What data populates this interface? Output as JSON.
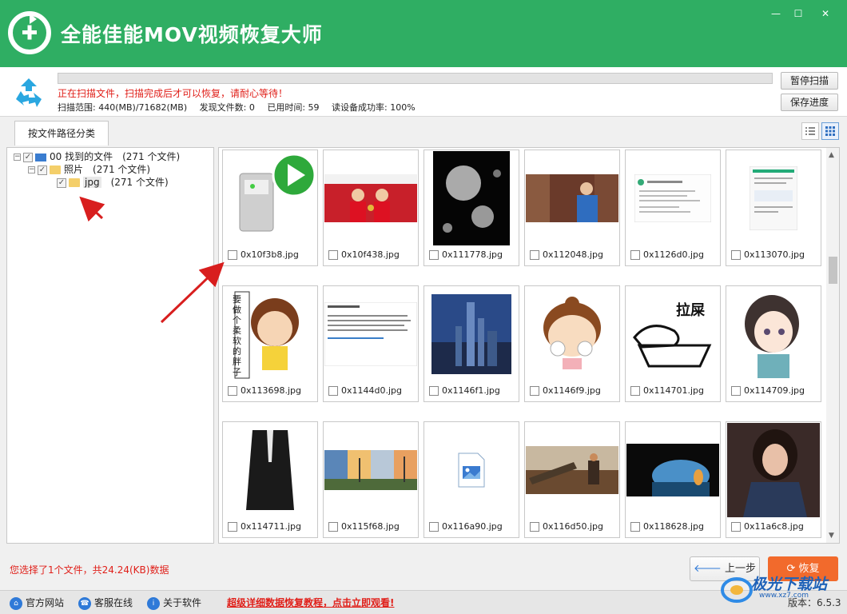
{
  "app": {
    "title": "全能佳能MOV视频恢复大师",
    "brand_color": "#2fae63"
  },
  "window_controls": {
    "minimize": "—",
    "maximize": "☐",
    "close": "✕"
  },
  "scan": {
    "message": "正在扫描文件，扫描完成后才可以恢复，请耐心等待！",
    "progress_fraction": 0.0,
    "range_label": "扫描范围: 440(MB)/71682(MB)",
    "found_label": "发现文件数: 0",
    "elapsed_label": "已用时间: 59",
    "success_label": "读设备成功率: 100%",
    "pause_button": "暂停扫描",
    "save_button": "保存进度"
  },
  "tabs": {
    "by_path": "按文件路径分类"
  },
  "tree": {
    "root": {
      "label": "00 找到的文件",
      "count": "(271 个文件)"
    },
    "photos": {
      "label": "照片",
      "count": "(271 个文件)"
    },
    "jpg": {
      "label": "jpg",
      "count": "(271 个文件)"
    }
  },
  "files": [
    {
      "name": "0x10f3b8.jpg",
      "kind": "player-icon",
      "checked": false
    },
    {
      "name": "0x10f438.jpg",
      "kind": "photo-athletes",
      "checked": false
    },
    {
      "name": "0x111778.jpg",
      "kind": "photo-moons",
      "checked": false
    },
    {
      "name": "0x112048.jpg",
      "kind": "photo-person-street",
      "checked": false
    },
    {
      "name": "0x1126d0.jpg",
      "kind": "screenshot-text",
      "checked": false
    },
    {
      "name": "0x113070.jpg",
      "kind": "screenshot-phone",
      "checked": false
    },
    {
      "name": "0x113698.jpg",
      "kind": "cartoon-girl",
      "checked": false
    },
    {
      "name": "0x1144d0.jpg",
      "kind": "screenshot-post",
      "checked": false
    },
    {
      "name": "0x1146f1.jpg",
      "kind": "photo-skyline",
      "checked": false
    },
    {
      "name": "0x1146f9.jpg",
      "kind": "cartoon-chibi",
      "checked": false
    },
    {
      "name": "0x114701.jpg",
      "kind": "sketch-bird",
      "checked": false
    },
    {
      "name": "0x114709.jpg",
      "kind": "anime-girl",
      "checked": false
    },
    {
      "name": "0x114711.jpg",
      "kind": "photo-suit",
      "checked": false
    },
    {
      "name": "0x115f68.jpg",
      "kind": "photo-strip",
      "checked": false
    },
    {
      "name": "0x116a90.jpg",
      "kind": "generic-image-icon",
      "checked": false
    },
    {
      "name": "0x116d50.jpg",
      "kind": "photo-western",
      "checked": false
    },
    {
      "name": "0x118628.jpg",
      "kind": "photo-cave",
      "checked": false
    },
    {
      "name": "0x11a6c8.jpg",
      "kind": "photo-woman",
      "checked": false
    }
  ],
  "sketch_text": "拉屎",
  "cartoon_text": "要做个柔软的胖子",
  "status": {
    "selection": "您选择了1个文件，共24.24(KB)数据",
    "prev_button": "上一步",
    "recover_button": "恢复"
  },
  "footer": {
    "website": "官方网站",
    "support": "客服在线",
    "about": "关于软件",
    "tutorial": "超级详细数据恢复教程，点击立即观看!",
    "version": "版本：6.5.3"
  },
  "watermark": {
    "text": "极光下载站",
    "url": "www.xz7.com"
  },
  "colors": {
    "accent_red": "#e0201a",
    "recover_orange": "#f26a2c",
    "link_blue": "#2f7ad8"
  }
}
